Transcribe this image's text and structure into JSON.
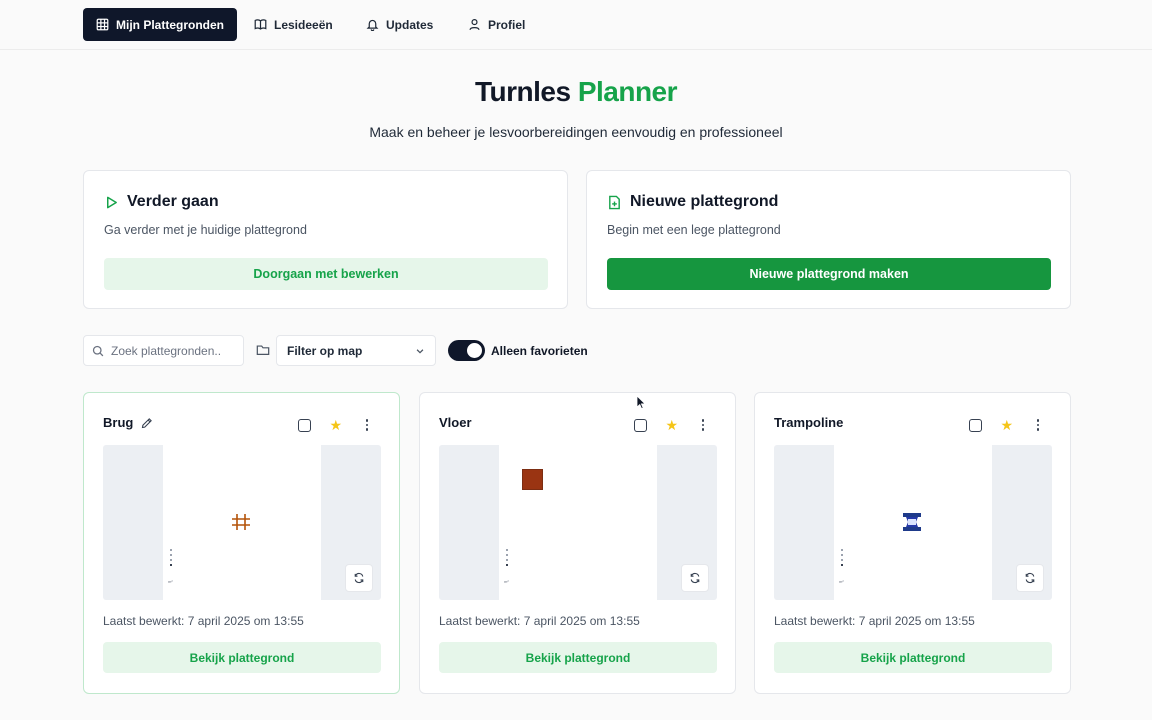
{
  "nav": {
    "items": [
      {
        "label": "Mijn Plattegronden",
        "icon": "grid-icon",
        "active": true
      },
      {
        "label": "Lesideeën",
        "icon": "book-icon",
        "active": false
      },
      {
        "label": "Updates",
        "icon": "bell-icon",
        "active": false
      },
      {
        "label": "Profiel",
        "icon": "user-icon",
        "active": false
      }
    ]
  },
  "header": {
    "title_main": "Turnles",
    "title_accent": "Planner",
    "subtitle": "Maak en beheer je lesvoorbereidingen eenvoudig en professioneel"
  },
  "continue_card": {
    "title": "Verder gaan",
    "description": "Ga verder met je huidige plattegrond",
    "button": "Doorgaan met bewerken",
    "icon": "play-icon"
  },
  "new_card": {
    "title": "Nieuwe plattegrond",
    "description": "Begin met een lege plattegrond",
    "button": "Nieuwe plattegrond maken",
    "icon": "file-plus-icon"
  },
  "toolbar": {
    "search_placeholder": "Zoek plattegronden..",
    "filter_label": "Filter op map",
    "favorites_label": "Alleen favorieten",
    "favorites_on": true
  },
  "plans": [
    {
      "name": "Brug",
      "edited": "Laatst bewerkt: 7 april 2025 om 13:55",
      "button": "Bekijk plattegrond",
      "favorite": true,
      "equipment": "bars-icon"
    },
    {
      "name": "Vloer",
      "edited": "Laatst bewerkt: 7 april 2025 om 13:55",
      "button": "Bekijk plattegrond",
      "favorite": true,
      "equipment": "floor-mat-icon"
    },
    {
      "name": "Trampoline",
      "edited": "Laatst bewerkt: 7 april 2025 om 13:55",
      "button": "Bekijk plattegrond",
      "favorite": true,
      "equipment": "trampoline-icon"
    }
  ],
  "preview_unit": "m²",
  "colors": {
    "accent": "#16a34a",
    "accent_soft": "#e6f6ea",
    "primary_dark": "#0f172a",
    "star": "#f5c518",
    "mat_brown": "#9a3412",
    "trampoline_blue": "#1e3a8a"
  }
}
